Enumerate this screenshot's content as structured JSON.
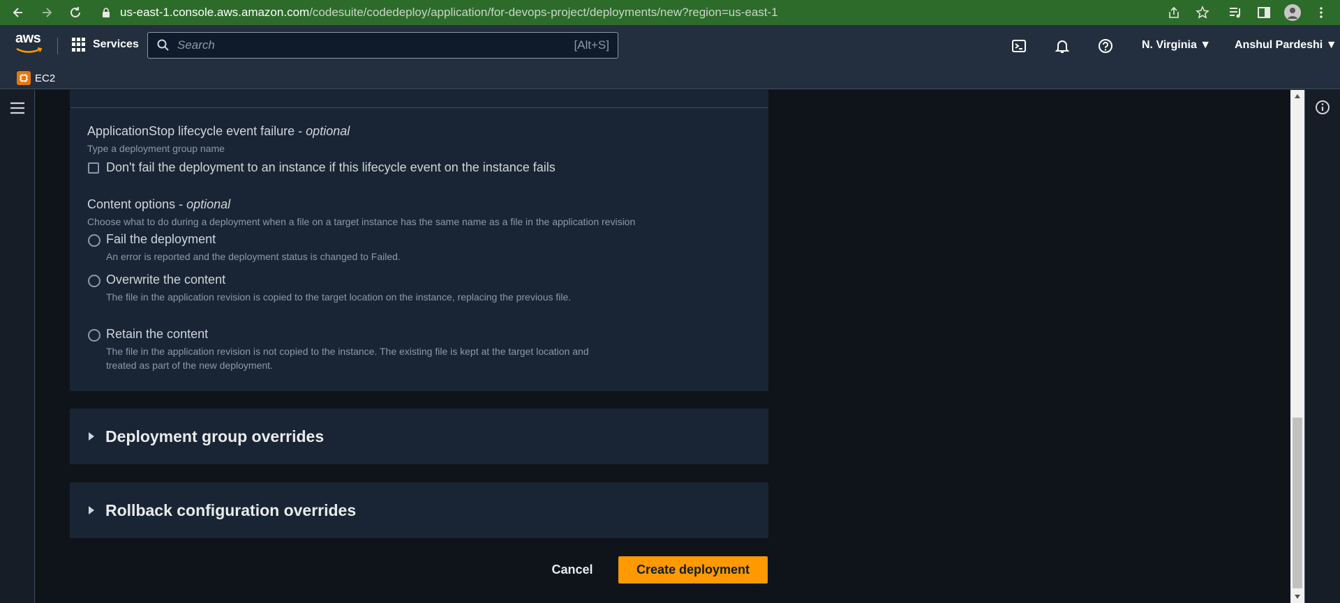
{
  "browser": {
    "url_host": "us-east-1.console.aws.amazon.com",
    "url_path": "/codesuite/codedeploy/application/for-devops-project/deployments/new?region=us-east-1"
  },
  "topnav": {
    "logo_text": "aws",
    "services_label": "Services",
    "search_placeholder": "Search",
    "search_shortcut": "[Alt+S]",
    "region_label": "N. Virginia ▼",
    "user_label": "Anshul Pardeshi ▼"
  },
  "favorites": {
    "ec2_label": "EC2"
  },
  "form": {
    "app_stop": {
      "label": "ApplicationStop lifecycle event failure - ",
      "optional": "optional",
      "description": "Type a deployment group name",
      "checkbox_label": "Don't fail the deployment to an instance if this lifecycle event on the instance fails",
      "checked": false
    },
    "content_options": {
      "label": "Content options - ",
      "optional": "optional",
      "description": "Choose what to do during a deployment when a file on a target instance has the same name as a file in the application revision",
      "options": [
        {
          "label": "Fail the deployment",
          "description": "An error is reported and the deployment status is changed to Failed."
        },
        {
          "label": "Overwrite the content",
          "description": "The file in the application revision is copied to the target location on the instance, replacing the previous file."
        },
        {
          "label": "Retain the content",
          "description": "The file in the application revision is not copied to the instance. The existing file is kept at the target location and treated as part of the new deployment."
        }
      ]
    },
    "sections": {
      "deployment_group_overrides": "Deployment group overrides",
      "rollback_overrides": "Rollback configuration overrides"
    },
    "actions": {
      "cancel": "Cancel",
      "create": "Create deployment"
    }
  },
  "colors": {
    "browser_bar": "#2d6b2a",
    "aws_nav": "#232f3e",
    "panel": "#192534",
    "primary_button": "#ff9900"
  }
}
